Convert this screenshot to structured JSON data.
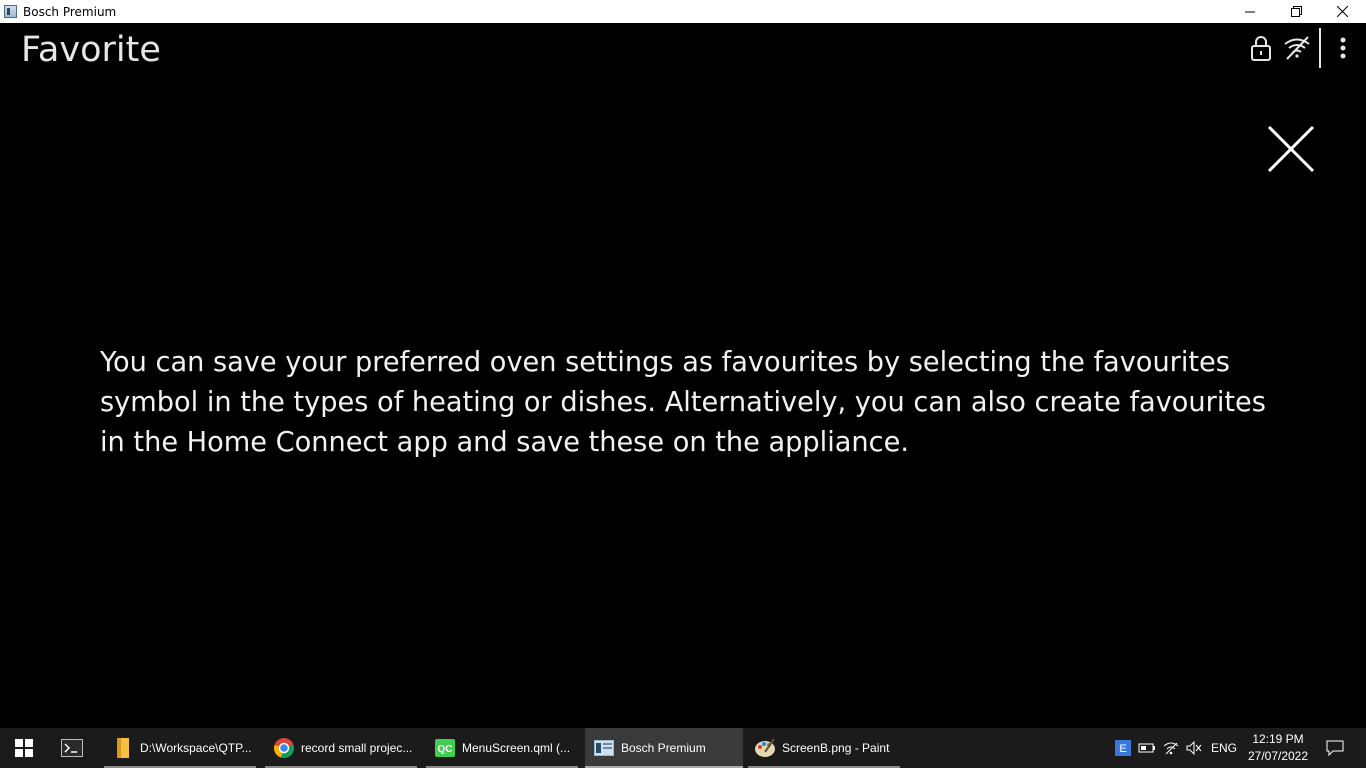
{
  "window": {
    "title": "Bosch Premium",
    "minimize": "—",
    "maximize": "❐",
    "close": "✕"
  },
  "header": {
    "title": "Favorite",
    "icons": [
      "lock-icon",
      "wifi-off-icon",
      "more-vertical-icon"
    ]
  },
  "content": {
    "info_text": "You can save your preferred oven settings as favourites by selecting the favourites symbol in the types of heating or dishes. Alternatively, you can also create favourites in the Home Connect app and save these on the appliance."
  },
  "taskbar": {
    "items": [
      {
        "label": "D:\\Workspace\\QTP...",
        "icon": "folder-icon"
      },
      {
        "label": "record small projec...",
        "icon": "chrome-icon"
      },
      {
        "label": "MenuScreen.qml (...",
        "icon": "qt-creator-icon"
      },
      {
        "label": "Bosch Premium",
        "icon": "app-window-icon"
      },
      {
        "label": "ScreenB.png - Paint",
        "icon": "paint-icon"
      }
    ],
    "tray": {
      "language": "ENG",
      "time": "12:19 PM",
      "date": "27/07/2022"
    }
  },
  "colors": {
    "background": "#000000",
    "text": "#f2f2f2",
    "taskbar": "#1b1b1b"
  }
}
